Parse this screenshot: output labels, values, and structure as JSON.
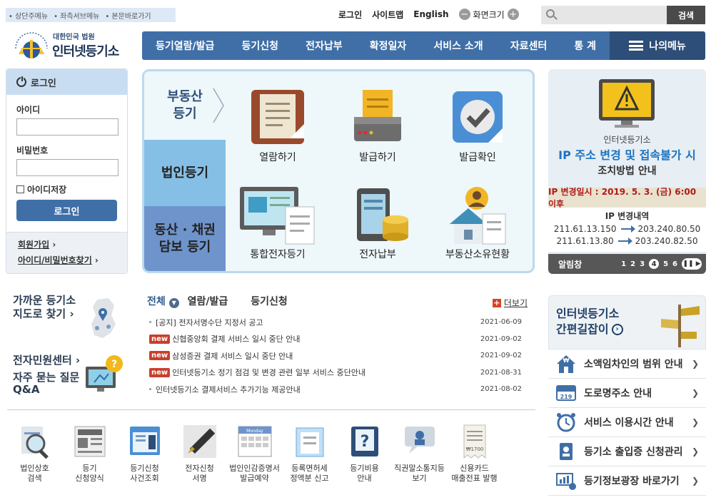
{
  "skip_nav": [
    "• 상단주메뉴",
    "• 좌측서브메뉴",
    "• 본문바로가기"
  ],
  "top_links": {
    "login": "로그인",
    "sitemap": "사이트맵",
    "english": "English",
    "zoom": "화면크기"
  },
  "search": {
    "button": "검색",
    "placeholder": ""
  },
  "logo": {
    "sub": "대한민국 법원",
    "main": "인터넷등기소"
  },
  "nav": [
    "등기열람/발급",
    "등기신청",
    "전자납부",
    "확정일자",
    "서비스 소개",
    "자료센터",
    "통 계"
  ],
  "my_menu": "나의메뉴",
  "login": {
    "title": "로그인",
    "id_label": "아이디",
    "pw_label": "비밀번호",
    "save_id": "아이디저장",
    "button": "로그인",
    "join": "회원가입",
    "find": "아이디/비밀번호찾기"
  },
  "center_tabs": {
    "realestate": "부동산\n등기",
    "corp": "법인등기",
    "movable": "동산 · 채권\n담보 등기"
  },
  "services": [
    "열람하기",
    "발급하기",
    "발급확인",
    "통합전자등기",
    "전자납부",
    "부동산소유현황"
  ],
  "notice_banner": {
    "l1": "인터넷등기소",
    "l2": "IP 주소 변경 및 접속불가 시",
    "l3": "조치방법 안내",
    "date": "IP 변경일시 : 2019. 5. 3. (금) 6:00 이후",
    "list_title": "IP 변경내역",
    "rows": [
      {
        "from": "211.61.13.150",
        "to": "203.240.80.50"
      },
      {
        "from": "211.61.13.80",
        "to": "203.240.82.50"
      }
    ],
    "alarm": "알림창",
    "pages": [
      "1",
      "2",
      "3",
      "4",
      "5",
      "6"
    ],
    "current_page": "4"
  },
  "left_links": {
    "map1": "가까운 등기소",
    "map2": "지도로 찾기",
    "civil": "전자민원센터",
    "faq1": "자주 묻는 질문",
    "faq2": "Q&A"
  },
  "news": {
    "tabs": [
      "전체",
      "열람/발급",
      "등기신청"
    ],
    "more": "더보기",
    "new_badge": "new",
    "items": [
      {
        "text": "[공지] 전자서명수단 지정서 공고",
        "date": "2021-06-09",
        "new": false
      },
      {
        "text": "신협중앙회 결제 서비스 일시 중단 안내",
        "date": "2021-09-02",
        "new": true
      },
      {
        "text": "삼성증권 결제 서비스 일시 중단 안내",
        "date": "2021-09-02",
        "new": true
      },
      {
        "text": "인터넷등기소 정기 점검 및 변경 관련 일부 서비스 중단안내",
        "date": "2021-08-31",
        "new": true
      },
      {
        "text": "인터넷등기소 결제서비스 추가기능 제공안내",
        "date": "2021-08-02",
        "new": false
      }
    ]
  },
  "quick": [
    {
      "l1": "법인상호",
      "l2": "검색"
    },
    {
      "l1": "등기",
      "l2": "신청양식"
    },
    {
      "l1": "등기신청",
      "l2": "사건조회"
    },
    {
      "l1": "전자신청",
      "l2": "서명"
    },
    {
      "l1": "법인인감증명서",
      "l2": "발급예약"
    },
    {
      "l1": "등록면허세",
      "l2": "정액분 신고"
    },
    {
      "l1": "등기비용",
      "l2": "안내"
    },
    {
      "l1": "직권말소통지등",
      "l2": "보기"
    },
    {
      "l1": "신용카드",
      "l2": "매출전표 발행"
    }
  ],
  "quick_icon_label": "Monday",
  "quick_icon_price": "₩1700",
  "guide": {
    "l1": "인터넷등기소",
    "l2": "간편길잡이"
  },
  "right_items": [
    "소액임차인의 범위 안내",
    "도로명주소 안내",
    "서비스 이용시간 안내",
    "등기소 출입증 신청관리",
    "등기정보광장 바로가기"
  ],
  "road_badge": "219",
  "colors": {
    "nav": "#3f6fa6",
    "mymenu": "#2d4e78",
    "accent_red": "#c7402b",
    "banner_blue": "#1c74c0"
  }
}
